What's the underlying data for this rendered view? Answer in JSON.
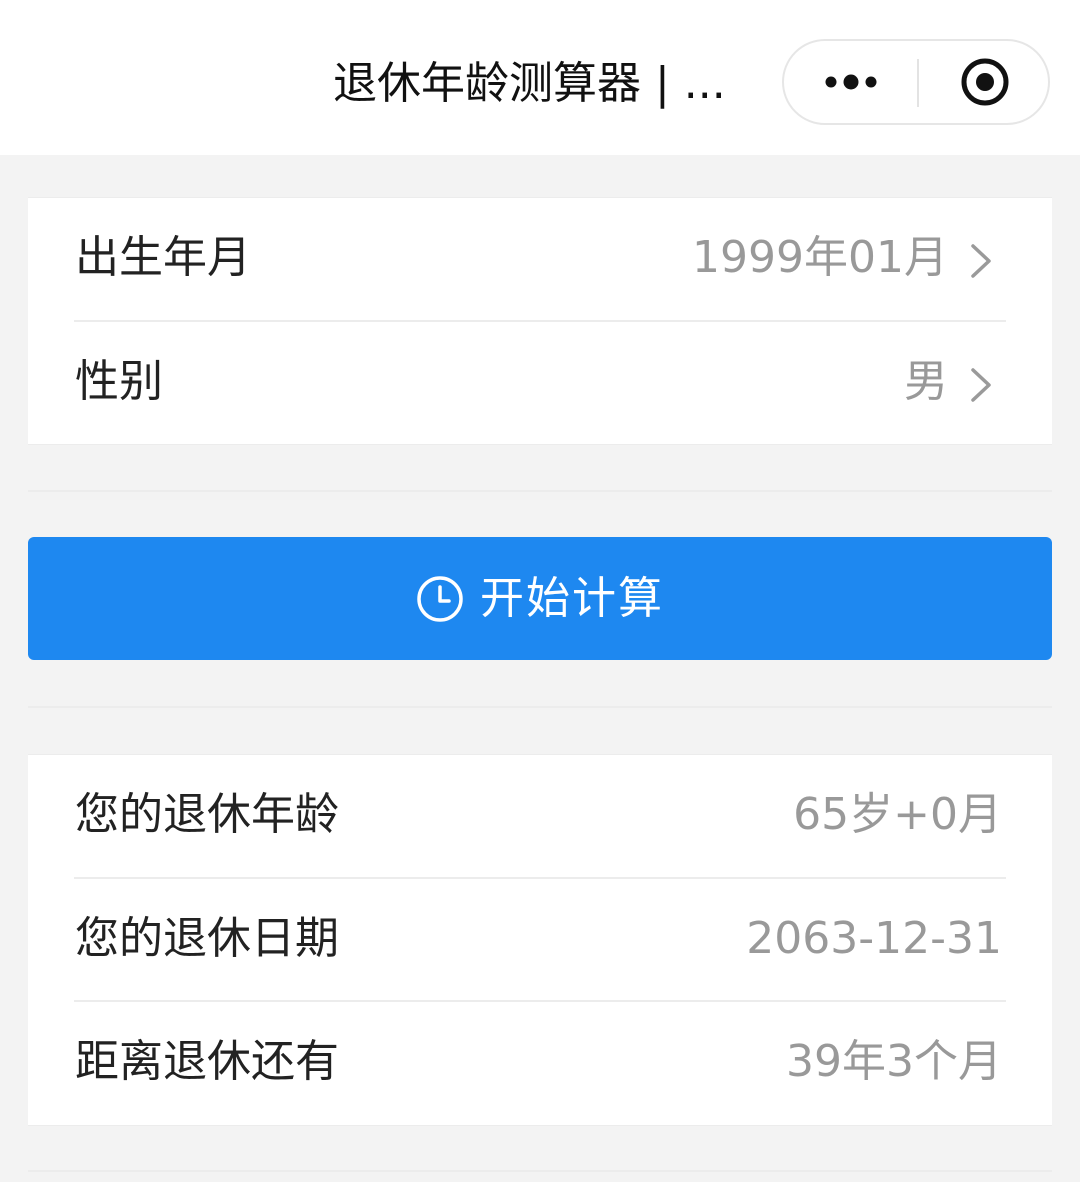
{
  "navbar": {
    "title": "退休年龄测算器 | ...",
    "more_icon": "more-dots-icon",
    "close_icon": "target-circle-icon"
  },
  "form": {
    "birth": {
      "label": "出生年月",
      "value": "1999年01月"
    },
    "gender": {
      "label": "性别",
      "value": "男"
    }
  },
  "action": {
    "label": "开始计算",
    "icon": "clock-icon"
  },
  "results": {
    "age": {
      "label": "您的退休年龄",
      "value": "65岁+0月"
    },
    "date": {
      "label": "您的退休日期",
      "value": "2063-12-31"
    },
    "remaining": {
      "label": "距离退休还有",
      "value": "39年3个月"
    }
  },
  "colors": {
    "primary": "#1e88f0",
    "page_bg": "#f3f3f3",
    "label_text": "#222222",
    "value_text": "#999999"
  }
}
